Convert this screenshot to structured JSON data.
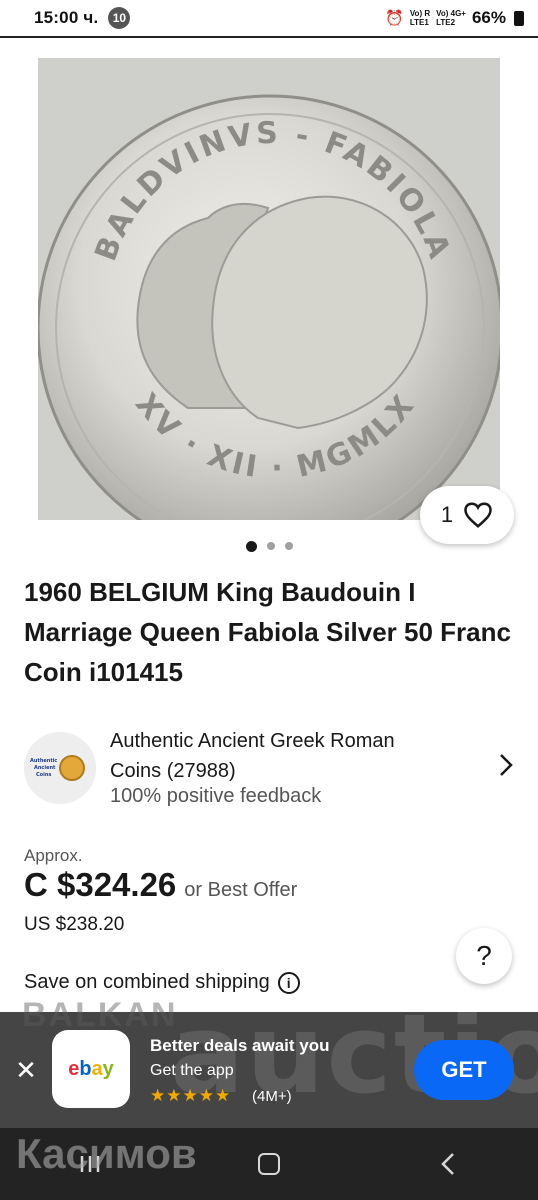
{
  "status_bar": {
    "time": "15:00 ч.",
    "notification_count": "10",
    "sim1": "Vo) R\nLTE1",
    "sim2": "Vo) 4G+\nLTE2",
    "battery": "66%"
  },
  "hero": {
    "coin_legend_top": "BALDVINVS - FABIOLA",
    "coin_legend_bottom": "XV · XII · MGMLX",
    "like_count": "1",
    "carousel_total": 3,
    "carousel_active": 1
  },
  "listing": {
    "title": "1960 BELGIUM King Baudouin I Marriage Queen Fabiola Silver 50 Franc Coin i101415"
  },
  "seller": {
    "name": "Authentic Ancient Greek Roman Coins (27988)",
    "feedback": "100% positive feedback",
    "logo_text": "Authentic Ancient Coins"
  },
  "price": {
    "approx_label": "Approx.",
    "amount": "C $324.26",
    "best_offer": "or Best Offer",
    "us_amount": "US $238.20"
  },
  "shipping": {
    "label": "Save on combined shipping"
  },
  "help_button": {
    "label": "?"
  },
  "watermark": {
    "top": "BALKAN",
    "middle": "auction",
    "bottom": "Касимов"
  },
  "app_banner": {
    "title": "Better deals await you",
    "subtitle": "Get the app",
    "stars": "★★★★★",
    "rating": "(4M+)",
    "cta": "GET",
    "colors": {
      "background": "#454545",
      "cta": "#0968f6",
      "stars": "#f2a900"
    }
  },
  "nav": {
    "recents_icon": "recents-icon",
    "home_icon": "home-icon",
    "back_icon": "back-icon"
  }
}
